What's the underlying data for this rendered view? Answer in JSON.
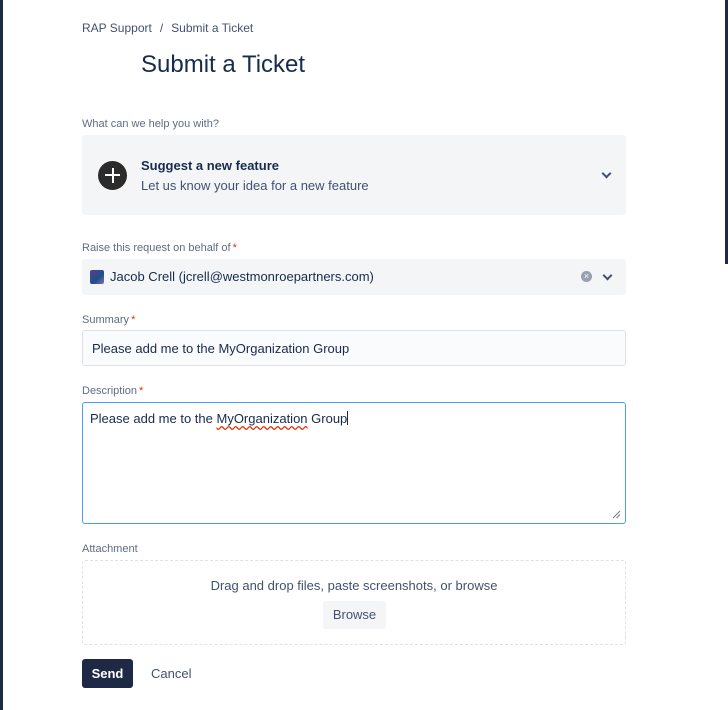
{
  "breadcrumb": {
    "root": "RAP Support",
    "separator": "/",
    "current": "Submit a Ticket"
  },
  "page": {
    "title": "Submit a Ticket"
  },
  "request_type": {
    "label": "What can we help you with?",
    "title": "Suggest a new feature",
    "description": "Let us know your idea for a new feature",
    "icon": "plus-circle-icon"
  },
  "behalf": {
    "label": "Raise this request on behalf of",
    "required_mark": "*",
    "value": "Jacob Crell (jcrell@westmonroepartners.com)"
  },
  "summary": {
    "label": "Summary",
    "required_mark": "*",
    "value": "Please add me to the MyOrganization Group"
  },
  "description": {
    "label": "Description",
    "required_mark": "*",
    "value_before": "Please add me to the ",
    "value_misspelled": "MyOrganization",
    "value_after": " Group"
  },
  "attachment": {
    "label": "Attachment",
    "prompt": "Drag and drop files, paste screenshots, or browse",
    "browse_label": "Browse"
  },
  "actions": {
    "send_label": "Send",
    "cancel_label": "Cancel"
  },
  "colors": {
    "primary": "#1e2a45",
    "required": "#de350b",
    "focus": "#4c9aff",
    "field_bg": "#f4f5f7"
  }
}
